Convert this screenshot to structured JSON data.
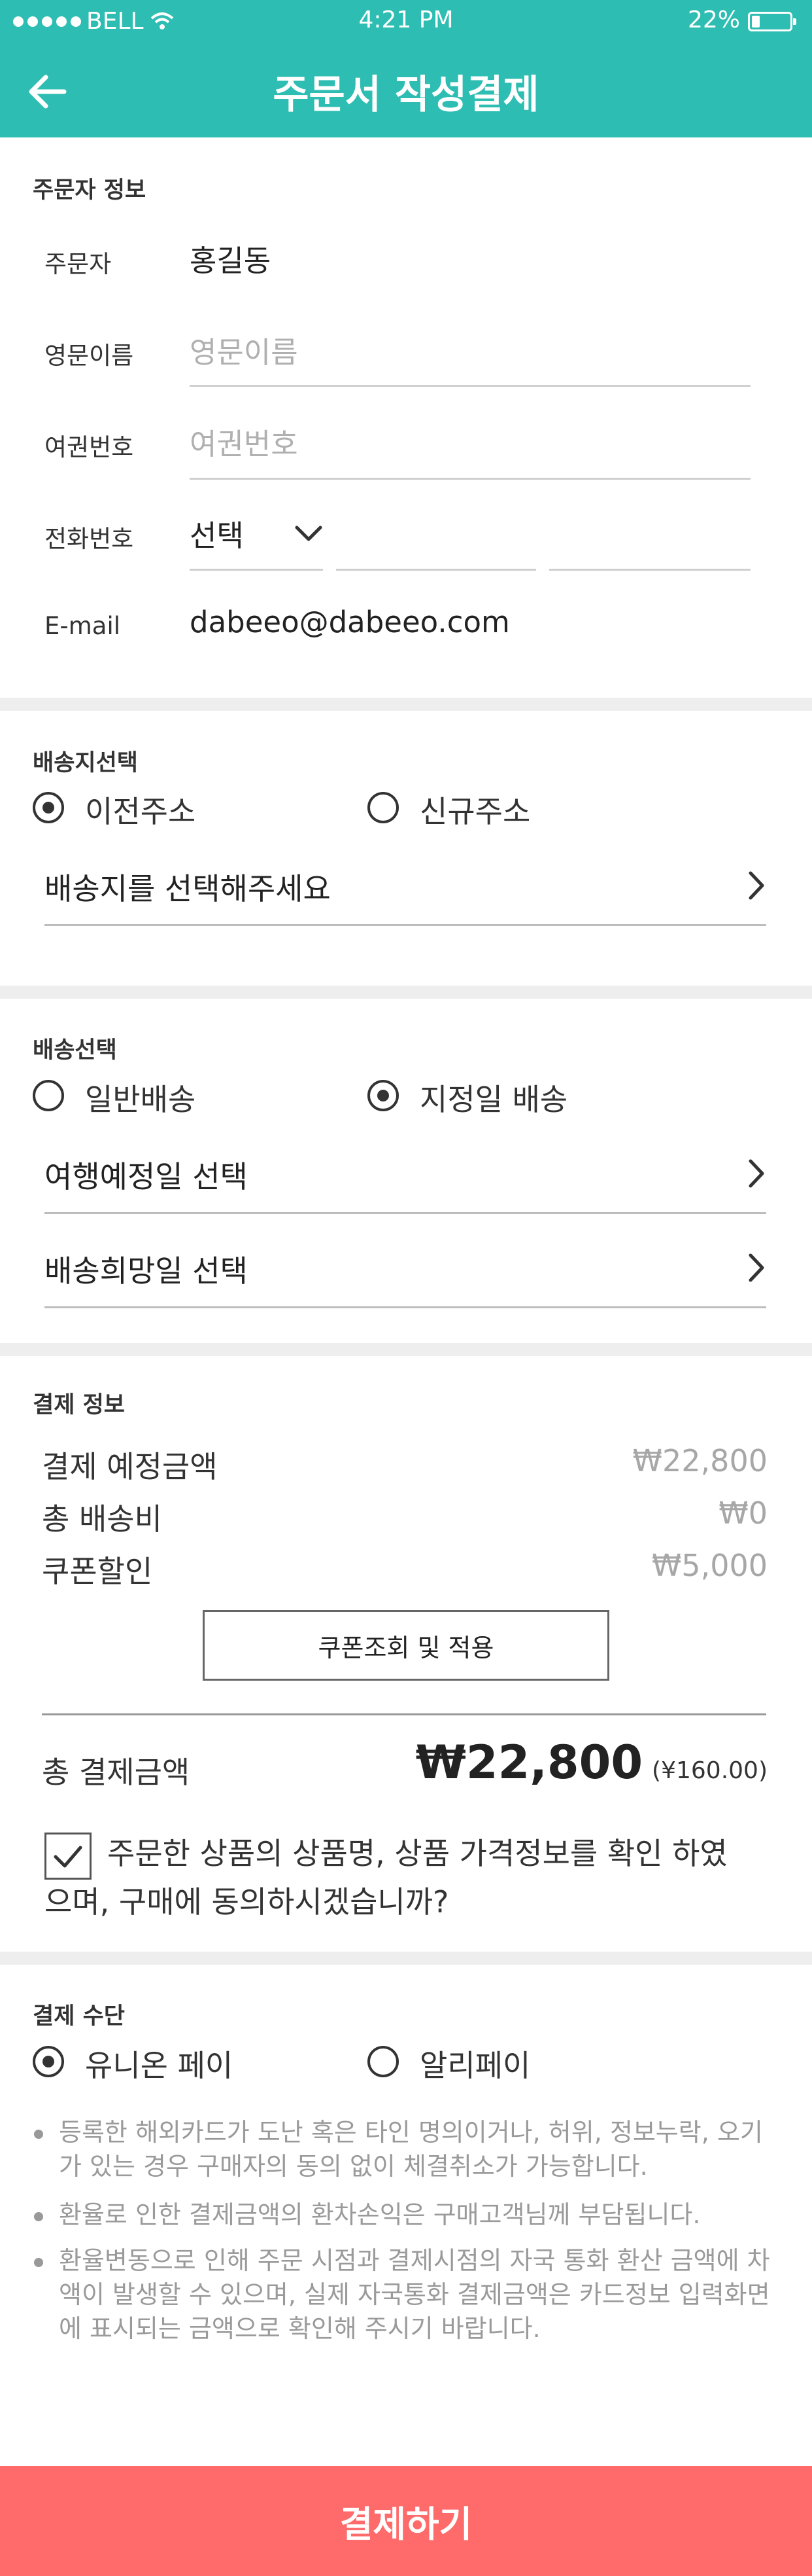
{
  "status_bar": {
    "carrier": "BELL",
    "time": "4:21 PM",
    "battery_pct": "22%",
    "battery_level": 0.22
  },
  "header": {
    "title": "주문서 작성결제"
  },
  "orderer": {
    "section_title": "주문자 정보",
    "name_label": "주문자",
    "name_value": "홍길동",
    "eng_label": "영문이름",
    "eng_placeholder": "영문이름",
    "passport_label": "여권번호",
    "passport_placeholder": "여권번호",
    "phone_label": "전화번호",
    "phone_select": "선택",
    "email_label": "E-mail",
    "email_value": "dabeeo@dabeeo.com"
  },
  "delivery_address": {
    "section_title": "배송지선택",
    "option_prev": "이전주소",
    "option_new": "신규주소",
    "select_label": "배송지를 선택해주세요"
  },
  "delivery_method": {
    "section_title": "배송선택",
    "option_normal": "일반배송",
    "option_scheduled": "지정일 배송",
    "travel_date_label": "여행예정일 선택",
    "delivery_date_label": "배송희망일 선택"
  },
  "payment_info": {
    "section_title": "결제 정보",
    "expected_label": "결제 예정금액",
    "expected_value": "₩22,800",
    "shipping_label": "총 배송비",
    "shipping_value": "₩0",
    "coupon_label": "쿠폰할인",
    "coupon_value": "₩5,000",
    "coupon_button": "쿠폰조회 및 적용",
    "total_label": "총 결제금액",
    "total_value": "₩22,800",
    "total_cny": "(¥160.00)",
    "agree_text_line1": "주문한 상품의 상품명, 상품 가격정보를 확인 하였",
    "agree_text_line2": "으며, 구매에 동의하시겠습니까?"
  },
  "payment_method": {
    "section_title": "결제 수단",
    "option_union": "유니온 페이",
    "option_ali": "알리페이",
    "notices": [
      "등록한 해외카드가 도난 혹은 타인 명의이거나, 허위, 정보누락, 오기가 있는 경우 구매자의 동의 없이 체결취소가 가능합니다.",
      "환율로 인한 결제금액의 환차손익은 구매고객님께 부담됩니다.",
      "환율변동으로 인해 주문 시점과 결제시점의 자국 통화 환산 금액에 차액이 발생할 수 있으며, 실제 자국통화 결제금액은 카드정보 입력화면에 표시되는 금액으로 확인해 주시기 바랍니다."
    ]
  },
  "cta": {
    "label": "결제하기"
  },
  "colors": {
    "brand": "#2ebdb2",
    "cta": "#ff6b6b"
  },
  "icons": [
    "back-arrow-icon",
    "wifi-icon",
    "battery-icon",
    "chevron-down-icon",
    "chevron-right-icon",
    "checkbox-icon"
  ]
}
